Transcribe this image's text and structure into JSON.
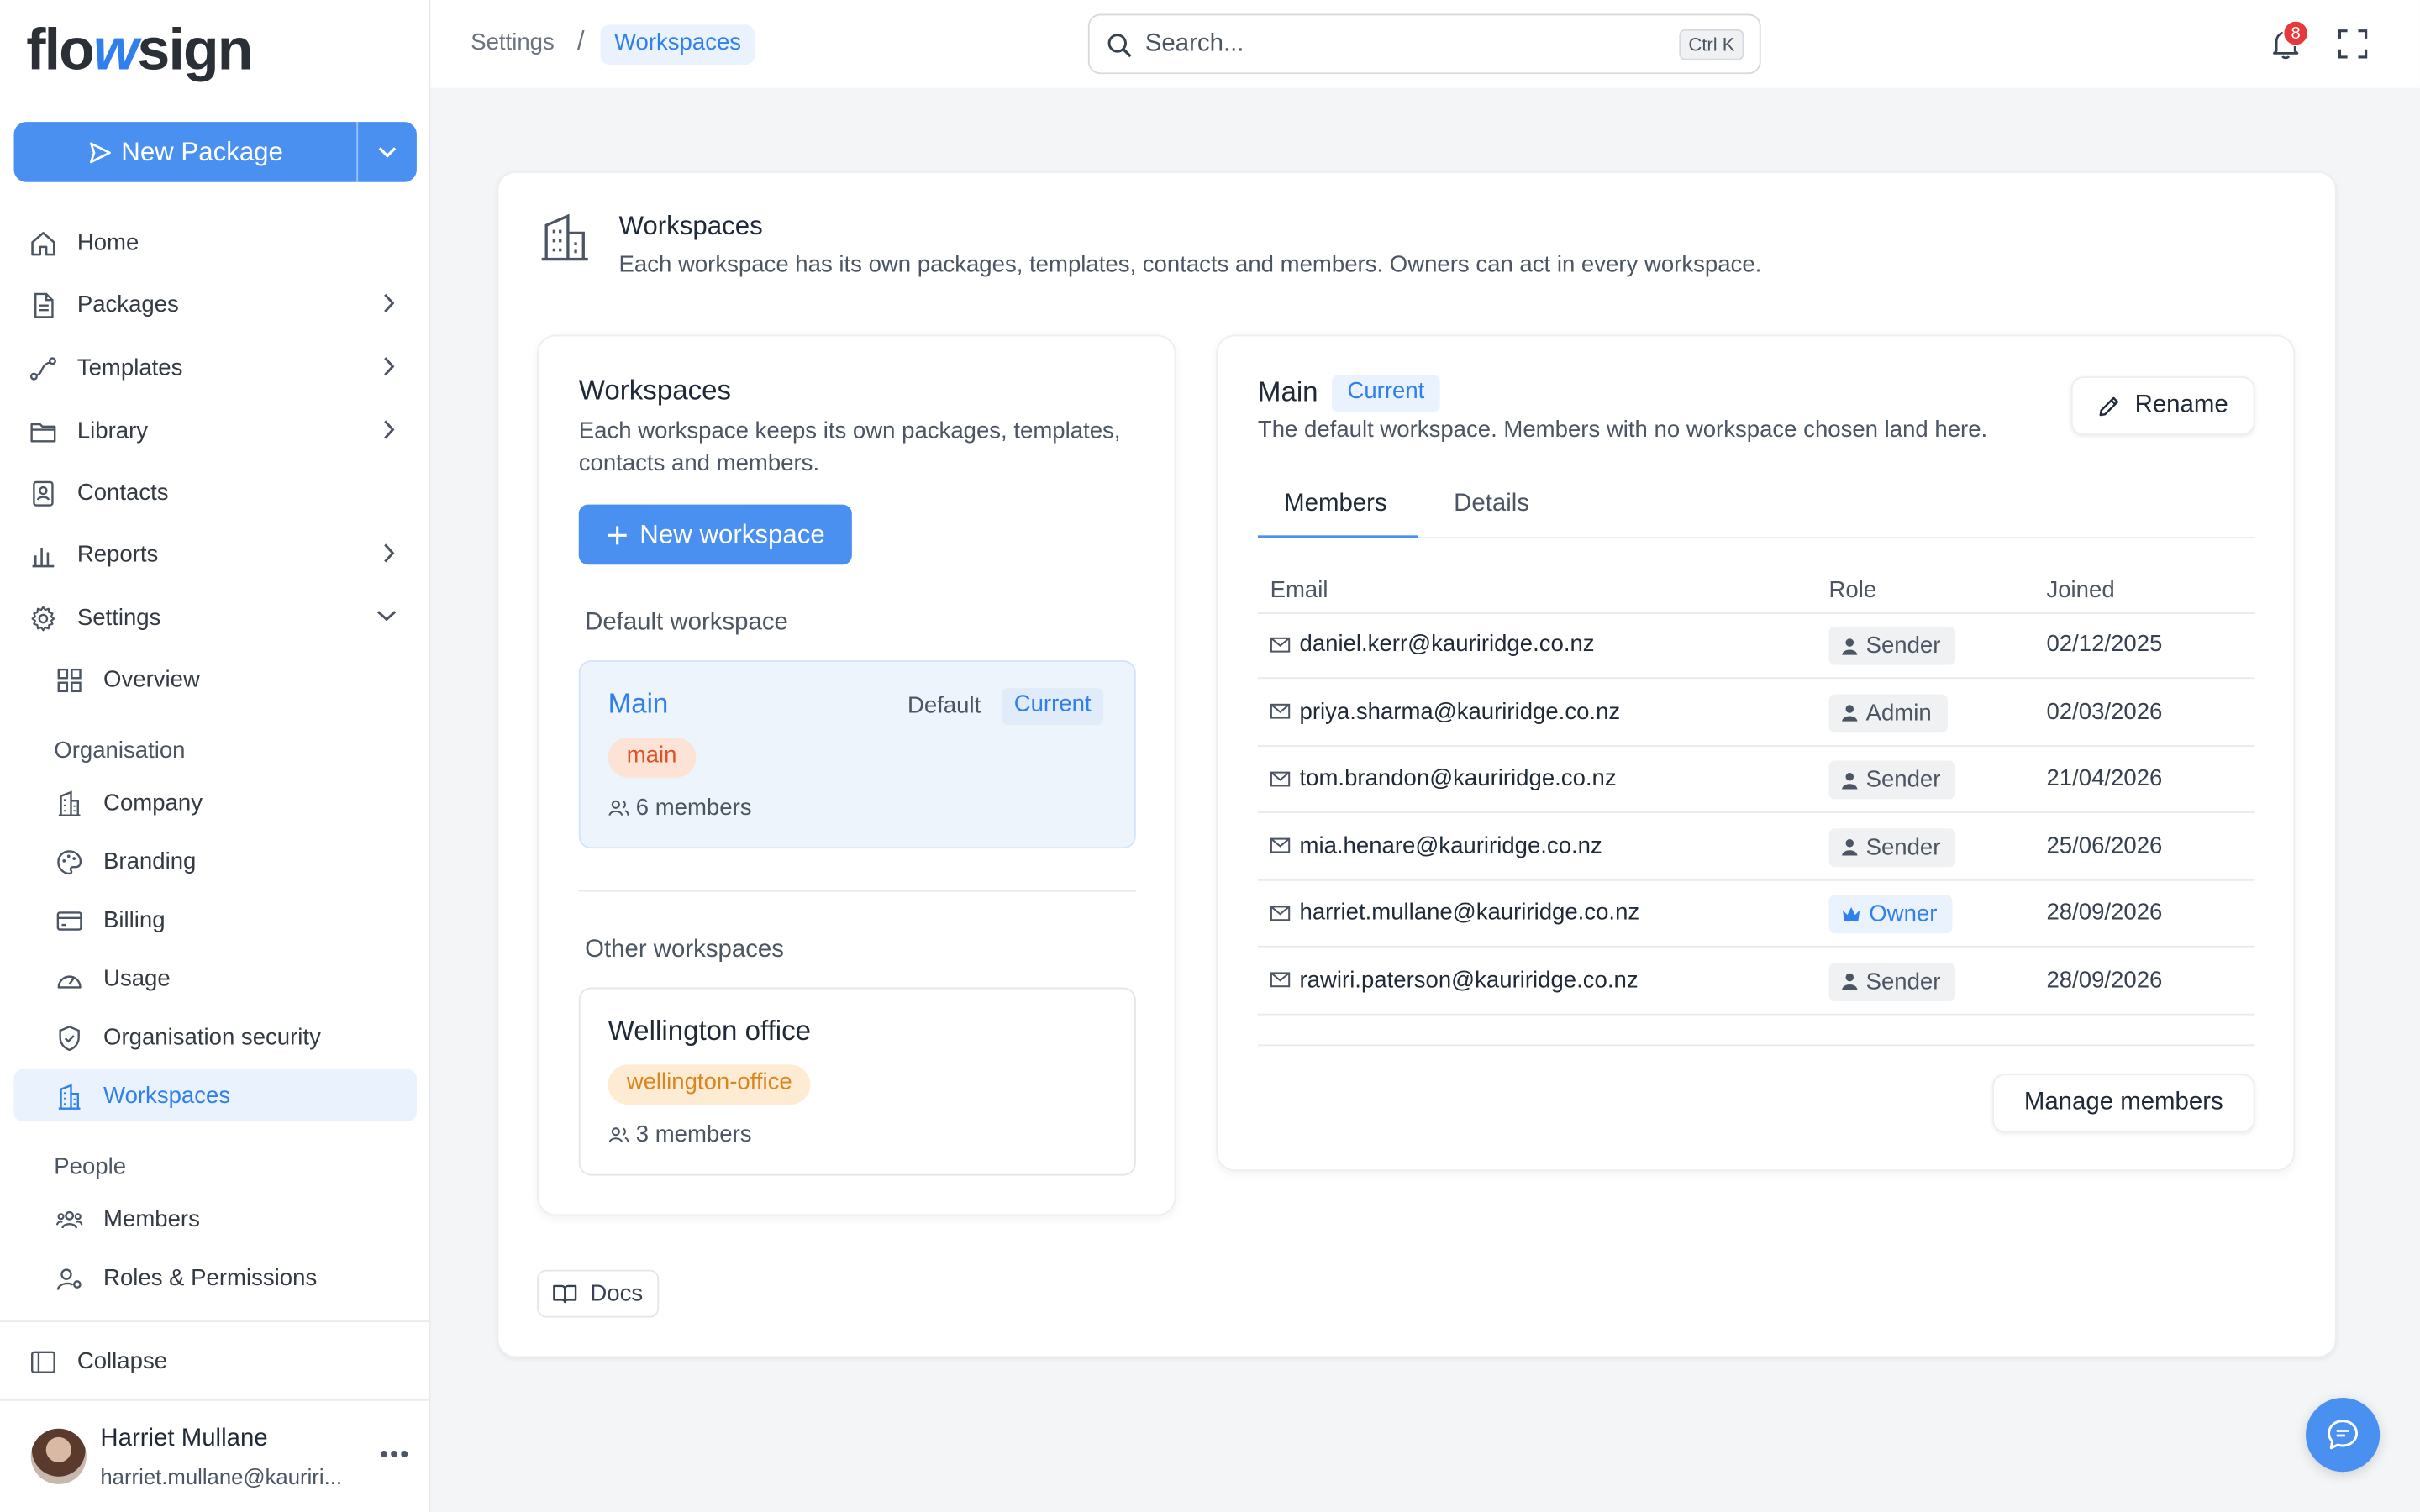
{
  "brand": {
    "logo_a": "flo",
    "logo_w": "w",
    "logo_b": "sign"
  },
  "sidebar": {
    "new_package": "New Package",
    "items": [
      {
        "label": "Home"
      },
      {
        "label": "Packages"
      },
      {
        "label": "Templates"
      },
      {
        "label": "Library"
      },
      {
        "label": "Contacts"
      },
      {
        "label": "Reports"
      },
      {
        "label": "Settings"
      },
      {
        "label": "Overview"
      }
    ],
    "section_org": "Organisation",
    "org_items": [
      {
        "label": "Company"
      },
      {
        "label": "Branding"
      },
      {
        "label": "Billing"
      },
      {
        "label": "Usage"
      },
      {
        "label": "Organisation security"
      },
      {
        "label": "Workspaces"
      }
    ],
    "section_people": "People",
    "people_items": [
      {
        "label": "Members"
      },
      {
        "label": "Roles & Permissions"
      }
    ],
    "collapse": "Collapse",
    "user": {
      "name": "Harriet Mullane",
      "email": "harriet.mullane@kauriri..."
    }
  },
  "topbar": {
    "breadcrumb": [
      "Settings",
      "Workspaces"
    ],
    "search_placeholder": "Search...",
    "search_shortcut": "Ctrl K",
    "notification_count": "8"
  },
  "page": {
    "title": "Workspaces",
    "subtitle": "Each workspace has its own packages, templates, contacts and members. Owners can act in every workspace.",
    "docs": "Docs"
  },
  "left_panel": {
    "title": "Workspaces",
    "subtitle": "Each workspace keeps its own packages, templates, contacts and members.",
    "new_button": "New workspace",
    "default_group": "Default workspace",
    "other_group": "Other workspaces",
    "default_ws": {
      "name": "Main",
      "tag_default": "Default",
      "tag_current": "Current",
      "slug": "main",
      "members": "6 members"
    },
    "other_ws": {
      "name": "Wellington office",
      "slug": "wellington-office",
      "members": "3 members"
    }
  },
  "right_panel": {
    "title": "Main",
    "current_badge": "Current",
    "subtitle": "The default workspace. Members with no workspace chosen land here.",
    "rename": "Rename",
    "tabs": [
      "Members",
      "Details"
    ],
    "columns": [
      "Email",
      "Role",
      "Joined"
    ],
    "rows": [
      {
        "email": "daniel.kerr@kauriridge.co.nz",
        "role": "Sender",
        "joined": "02/12/2025"
      },
      {
        "email": "priya.sharma@kauriridge.co.nz",
        "role": "Admin",
        "joined": "02/03/2026"
      },
      {
        "email": "tom.brandon@kauriridge.co.nz",
        "role": "Sender",
        "joined": "21/04/2026"
      },
      {
        "email": "mia.henare@kauriridge.co.nz",
        "role": "Sender",
        "joined": "25/06/2026"
      },
      {
        "email": "harriet.mullane@kauriridge.co.nz",
        "role": "Owner",
        "joined": "28/09/2026"
      },
      {
        "email": "rawiri.paterson@kauriridge.co.nz",
        "role": "Sender",
        "joined": "28/09/2026"
      }
    ],
    "manage": "Manage members"
  },
  "colors": {
    "accent": "#4a90f0",
    "accent_text": "#2f80ed",
    "slug_main_bg": "#fde3d6",
    "slug_main_fg": "#d9532b",
    "slug_other_bg": "#fdebd3",
    "slug_other_fg": "#d9861f"
  }
}
